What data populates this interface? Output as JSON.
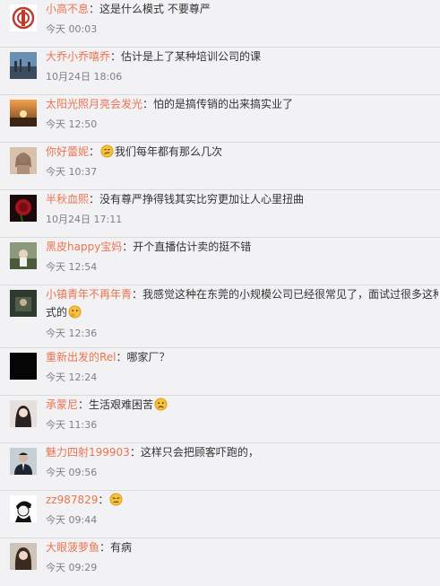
{
  "comments": [
    {
      "user": "小高不息",
      "text": "：这是什么模式  不要尊严",
      "time": "今天 00:03"
    },
    {
      "user": "大乔小乔嘻乔",
      "text": "：估计是上了某种培训公司的课",
      "time": "10月24日 18:06"
    },
    {
      "user": "太阳光照月亮会发光",
      "text": "：怕的是搞传销的出来搞实业了",
      "time": "今天 12:50"
    },
    {
      "user": "你好蕾妮",
      "text_before": "：",
      "emoji": "smirk-emoji",
      "text": "我们每年都有那么几次",
      "time": "今天 10:37"
    },
    {
      "user": "半秋血熙",
      "text": "：没有尊严挣得钱其实比穷更加让人心里扭曲",
      "time": "10月24日 17:11"
    },
    {
      "user": "黑皮happy宝妈",
      "text": "：开个直播估计卖的挺不错",
      "time": "今天 12:54"
    },
    {
      "user": "小镇青年不再年青",
      "text": "：我感觉这种在东莞的小规模公司已经很常见了，面试过很多这种",
      "text_cont": "式的",
      "emoji": "thinking-emoji",
      "time": "今天 12:36"
    },
    {
      "user": "重新出发的Rel",
      "text": "：哪家厂？",
      "time": "今天 12:24"
    },
    {
      "user": "承蒙尼",
      "text": "：生活艰难困苦",
      "emoji": "sad-emoji",
      "time": "今天 11:36"
    },
    {
      "user": "魅力四射199903",
      "text": "：这样只会把顾客吓跑的，",
      "time": "今天 09:56"
    },
    {
      "user": "zz987829",
      "text": "：",
      "emoji": "tired-emoji",
      "time": "今天 09:44"
    },
    {
      "user": "大眼菠萝鱼",
      "text": "：有病",
      "time": "今天 09:29"
    }
  ],
  "colors": {
    "username": "#eb7350",
    "text": "#333333",
    "time": "#808080",
    "background": "#f2f2f5",
    "divider": "#dadadd"
  }
}
